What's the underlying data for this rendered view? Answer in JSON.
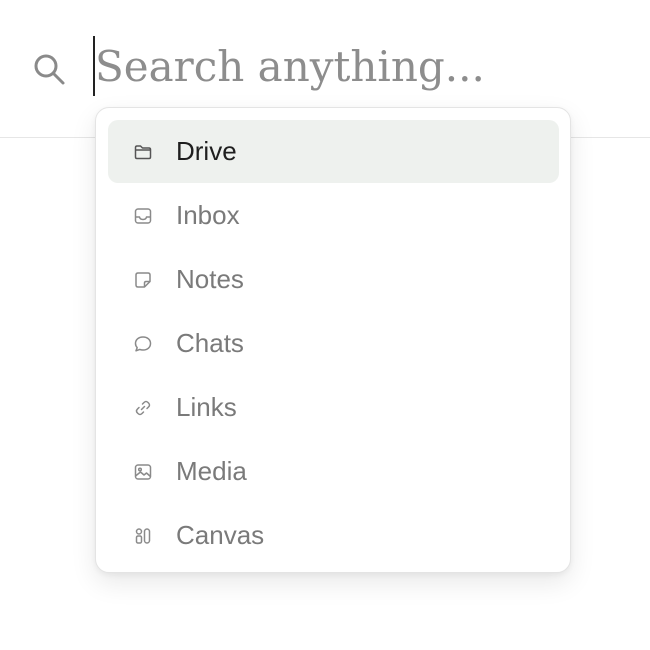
{
  "search": {
    "placeholder": "Search anything...",
    "value": "",
    "icon": "search-icon"
  },
  "menu": {
    "items": [
      {
        "label": "Drive",
        "icon": "folder-icon",
        "active": true
      },
      {
        "label": "Inbox",
        "icon": "inbox-icon",
        "active": false
      },
      {
        "label": "Notes",
        "icon": "note-icon",
        "active": false
      },
      {
        "label": "Chats",
        "icon": "chat-icon",
        "active": false
      },
      {
        "label": "Links",
        "icon": "link-icon",
        "active": false
      },
      {
        "label": "Media",
        "icon": "image-icon",
        "active": false
      },
      {
        "label": "Canvas",
        "icon": "canvas-icon",
        "active": false
      }
    ]
  },
  "colors": {
    "active_item_bg": "#eef1ee",
    "placeholder": "#8d8d8d",
    "label": "#7a7a7a",
    "active_label": "#1f1f1f"
  }
}
